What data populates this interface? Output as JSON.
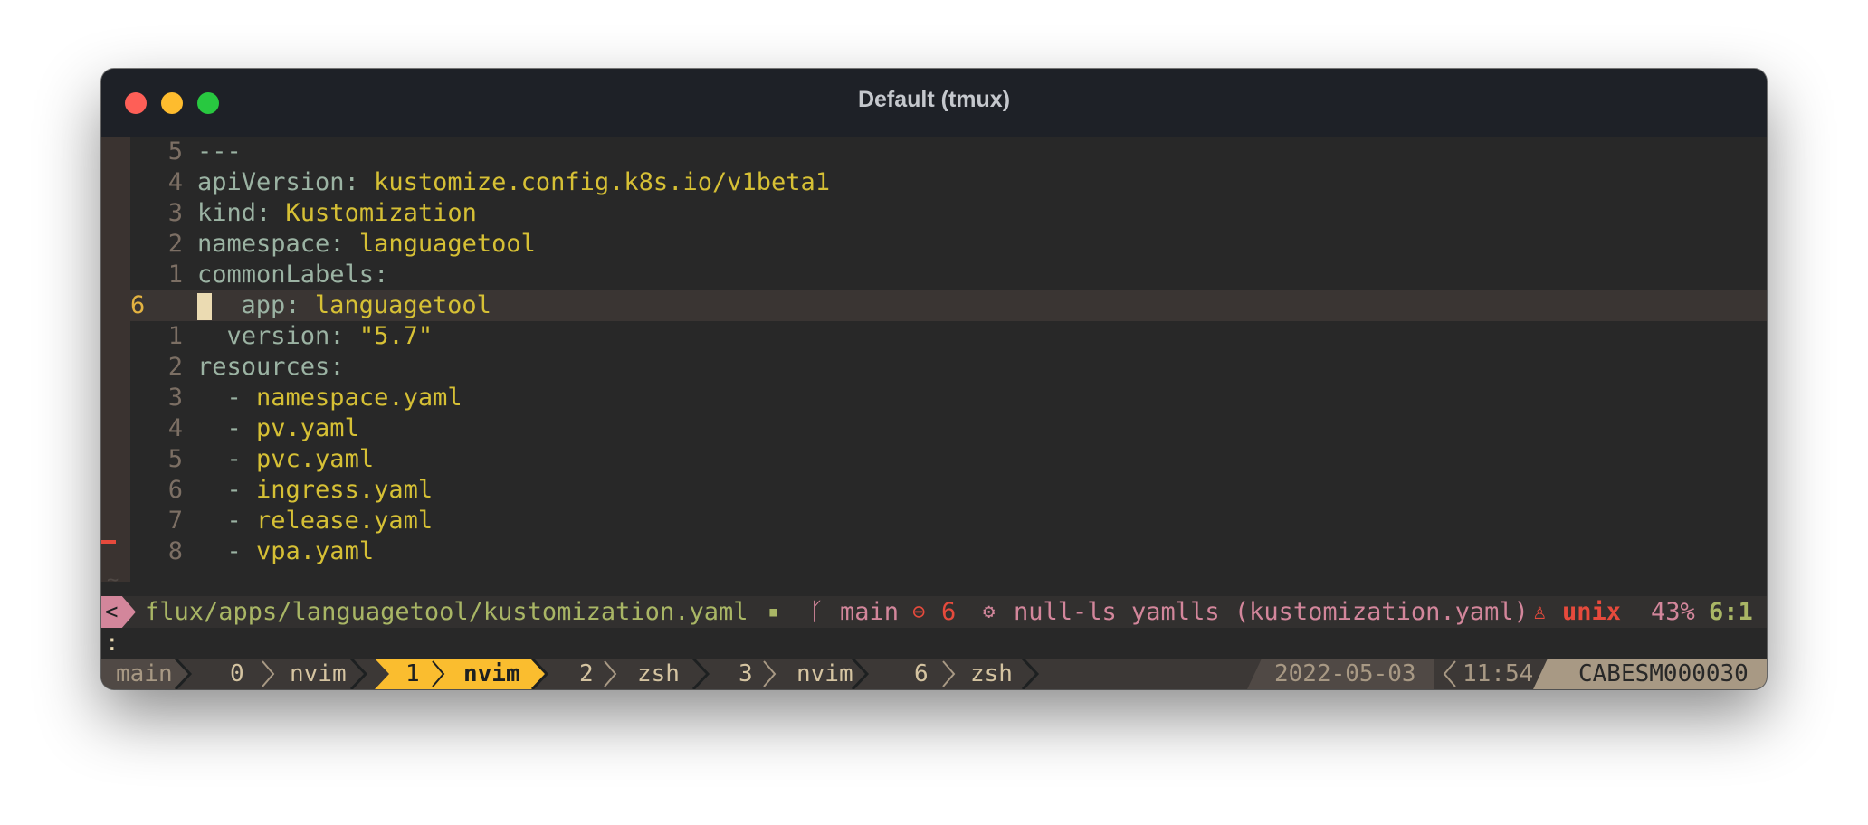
{
  "window": {
    "title": "Default (tmux)"
  },
  "editor": {
    "lines": [
      {
        "nr": "5",
        "key": "---",
        "sep": "",
        "value": ""
      },
      {
        "nr": "4",
        "key": "apiVersion",
        "sep": ": ",
        "value": "kustomize.config.k8s.io/v1beta1"
      },
      {
        "nr": "3",
        "key": "kind",
        "sep": ": ",
        "value": "Kustomization"
      },
      {
        "nr": "2",
        "key": "namespace",
        "sep": ": ",
        "value": "languagetool"
      },
      {
        "nr": "1",
        "key": "commonLabels",
        "sep": ":",
        "value": ""
      },
      {
        "nr": "6",
        "indent": "",
        "key": "app",
        "sep": ": ",
        "value": "languagetool"
      },
      {
        "nr": "1",
        "indent": "  ",
        "key": "version",
        "sep": ": ",
        "value": "\"5.7\""
      },
      {
        "nr": "2",
        "key": "resources",
        "sep": ":",
        "value": ""
      },
      {
        "nr": "3",
        "dash": "  - ",
        "value": "namespace.yaml"
      },
      {
        "nr": "4",
        "dash": "  - ",
        "value": "pv.yaml"
      },
      {
        "nr": "5",
        "dash": "  - ",
        "value": "pvc.yaml"
      },
      {
        "nr": "6",
        "dash": "  - ",
        "value": "ingress.yaml"
      },
      {
        "nr": "7",
        "dash": "  - ",
        "value": "release.yaml"
      },
      {
        "nr": "8",
        "dash": "  - ",
        "value": "vpa.yaml"
      }
    ],
    "tilde": "~"
  },
  "statusline": {
    "mode_glyph": "<",
    "file_path": "flux/apps/languagetool/kustomization.yaml",
    "save_glyph": "▪",
    "branch_glyph": "ᚴ",
    "branch": "main",
    "diag_glyph": "⊖",
    "diag_count": "6",
    "lsp_glyph": "⚙",
    "lsp_text": "null-ls yamlls (kustomization.yaml)",
    "os_glyph": "♙",
    "fileformat": "unix",
    "percent": "43%",
    "position": "6:1"
  },
  "cmdline": {
    "text": ":"
  },
  "tmux": {
    "session": "main",
    "windows": [
      {
        "index": "0",
        "name": "nvim",
        "active": false
      },
      {
        "index": "1",
        "name": "nvim",
        "active": true
      },
      {
        "index": "2",
        "name": "zsh",
        "active": false
      },
      {
        "index": "3",
        "name": "nvim",
        "active": false
      },
      {
        "index": "6",
        "name": "zsh",
        "active": false
      }
    ],
    "date": "2022-05-03",
    "time": "11:54",
    "host": "CABESM000030"
  },
  "colors": {
    "accent_yellow": "#fabd2f",
    "mode_pink": "#d3869b",
    "error_red": "#e64a3c",
    "string_green": "#a9b665"
  }
}
